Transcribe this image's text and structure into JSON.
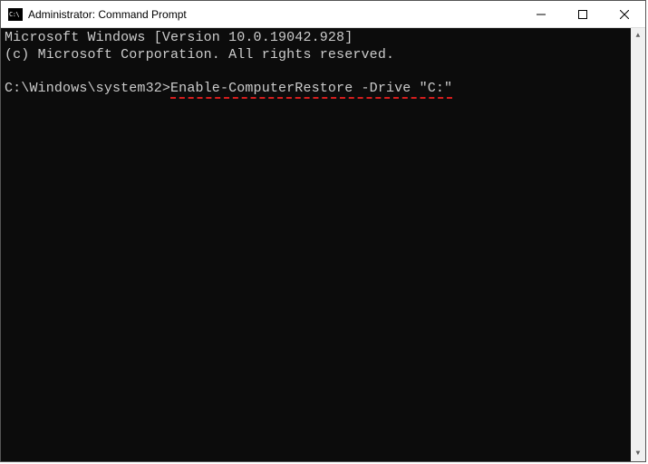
{
  "titlebar": {
    "title": "Administrator: Command Prompt"
  },
  "terminal": {
    "line1": "Microsoft Windows [Version 10.0.19042.928]",
    "line2": "(c) Microsoft Corporation. All rights reserved.",
    "prompt": "C:\\Windows\\system32>",
    "command": "Enable-ComputerRestore -Drive \"C:\""
  }
}
